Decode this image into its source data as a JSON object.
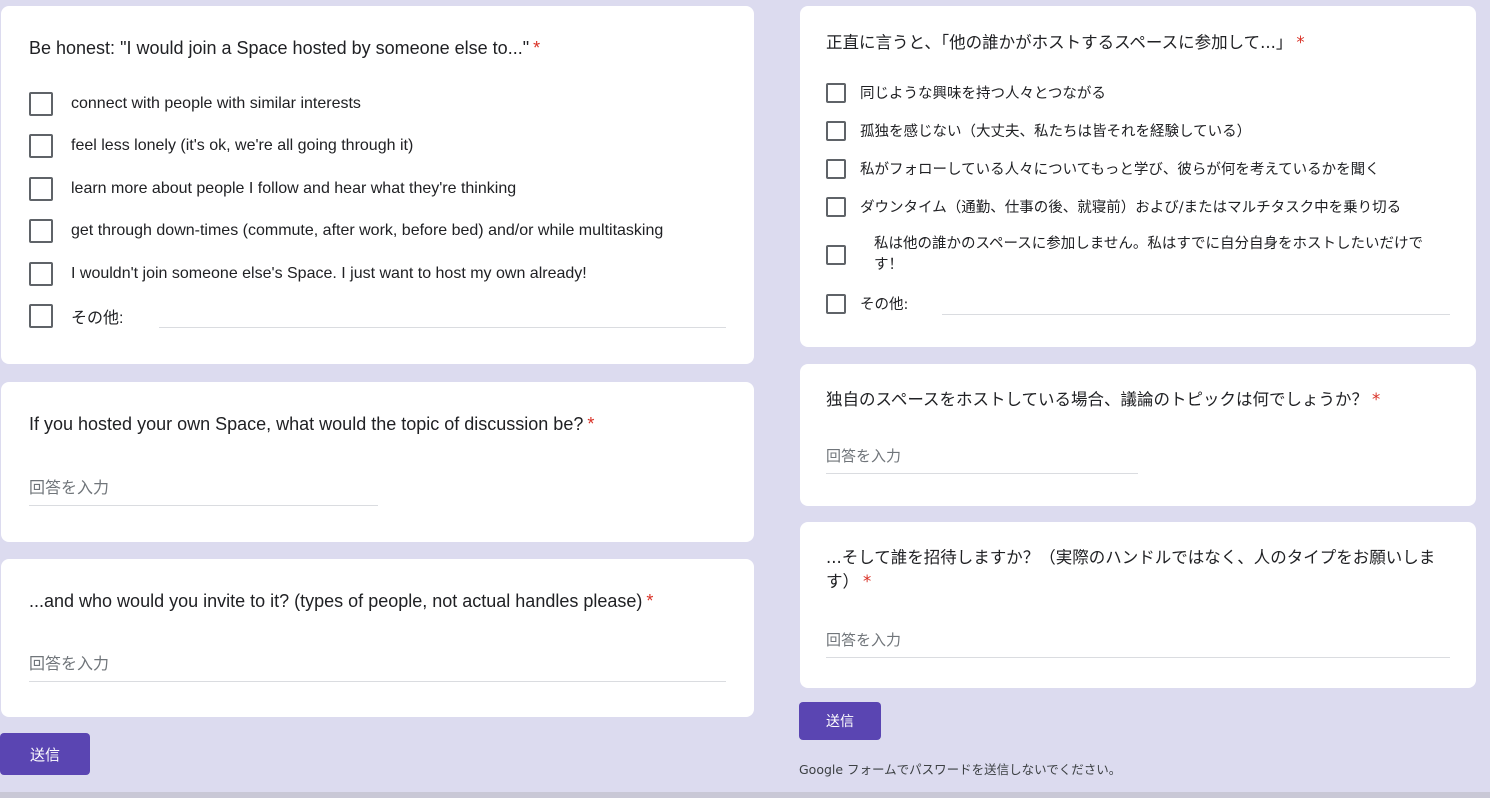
{
  "left": {
    "q1": {
      "title": "Be honest: \"I would join a Space hosted by someone else to...\"",
      "required": "*",
      "options": [
        "connect with people with similar interests",
        "feel less lonely (it's ok, we're all going through it)",
        "learn more about people I follow and hear what they're thinking",
        "get through down-times (commute, after work, before bed) and/or while multitasking",
        "I wouldn't join someone else's Space. I just want to host my own already!"
      ],
      "other_label": "その他:"
    },
    "q2": {
      "title": "If you hosted your own Space, what would the topic of discussion be?",
      "required": "*",
      "placeholder": "回答を入力"
    },
    "q3": {
      "title": "...and who would you invite to it? (types of people, not actual handles please)",
      "required": "*",
      "placeholder": "回答を入力"
    },
    "submit_label": "送信"
  },
  "right": {
    "q1": {
      "title": "正直に言うと、「他の誰かがホストするスペースに参加して...」",
      "required": "*",
      "options": [
        "同じような興味を持つ人々とつながる",
        "孤独を感じない（大丈夫、私たちは皆それを経験している）",
        "私がフォローしている人々についてもっと学び、彼らが何を考えているかを聞く",
        "ダウンタイム（通勤、仕事の後、就寝前）および/またはマルチタスク中を乗り切る"
      ],
      "option5_line1": "私は他の誰かのスペースに参加しません。私はすでに自分自身をホストしたいだけで",
      "option5_line2": "す！",
      "other_label": "その他:"
    },
    "q2": {
      "title": "独自のスペースをホストしている場合、議論のトピックは何でしょうか？",
      "required": "*",
      "placeholder": "回答を入力"
    },
    "q3": {
      "title_line1": "...そして誰を招待しますか？（実際のハンドルではなく、人のタイプをお願いしま",
      "title_line2": "す）",
      "required": "*",
      "placeholder": "回答を入力"
    },
    "submit_label": "送信",
    "footer_note": "Google フォームでパスワードを送信しないでください。"
  }
}
